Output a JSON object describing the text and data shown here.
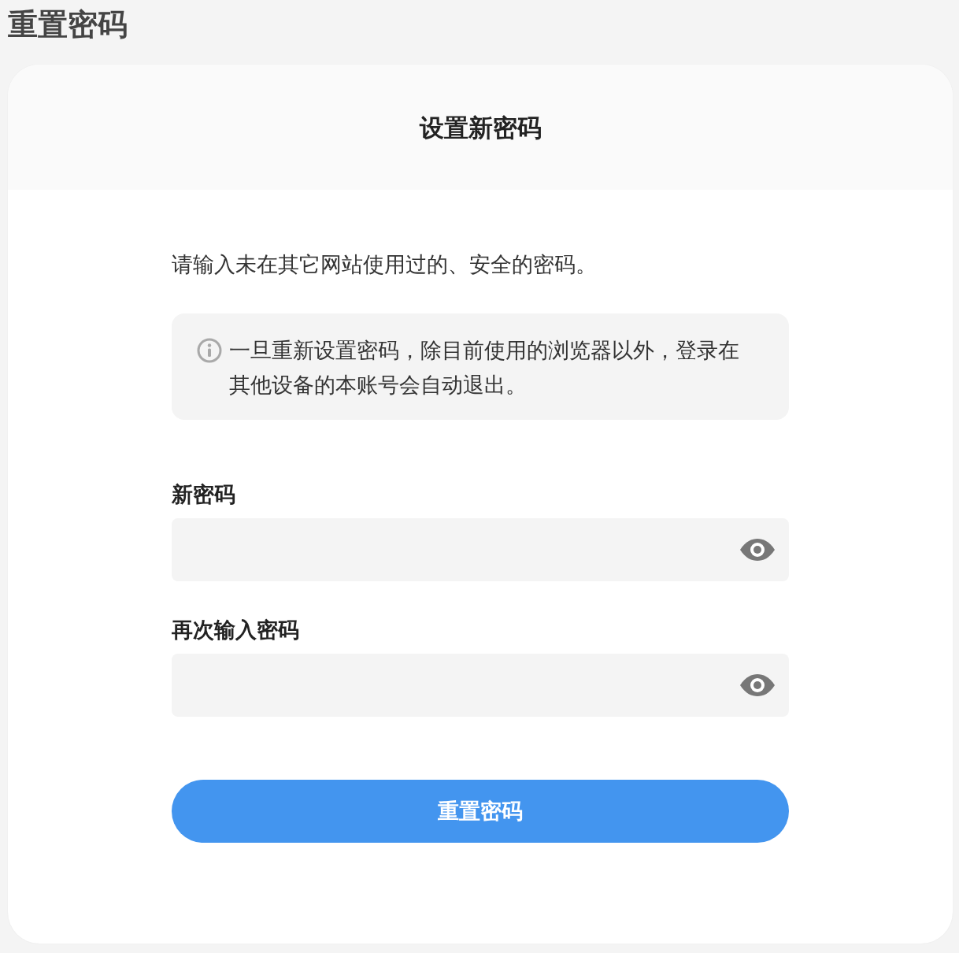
{
  "page": {
    "title": "重置密码"
  },
  "card": {
    "title": "设置新密码",
    "description": "请输入未在其它网站使用过的、安全的密码。",
    "notice": "一旦重新设置密码，除目前使用的浏览器以外，登录在其他设备的本账号会自动退出。",
    "fields": [
      {
        "label": "新密码"
      },
      {
        "label": "再次输入密码"
      }
    ],
    "submit_button": "重置密码"
  }
}
